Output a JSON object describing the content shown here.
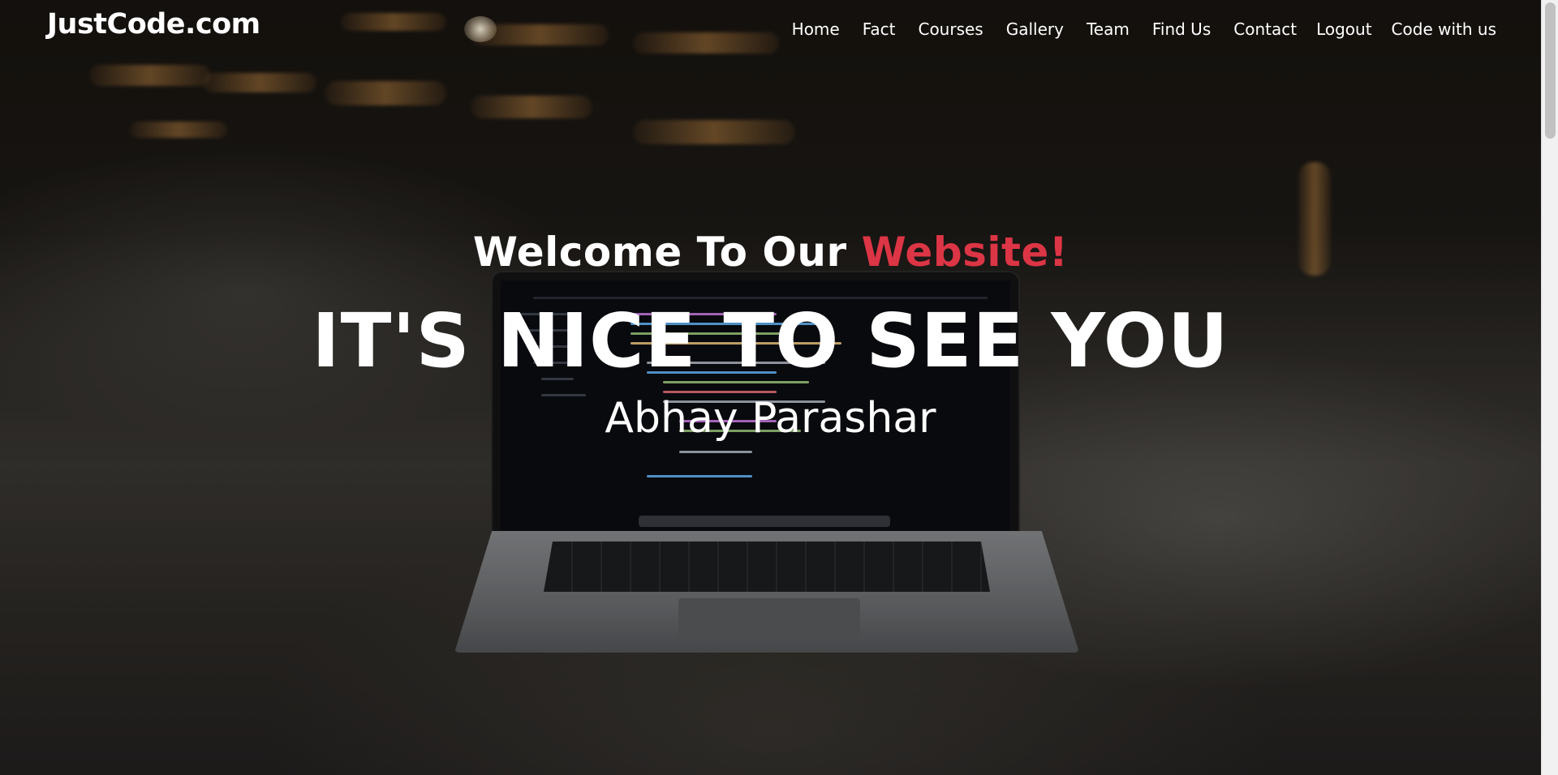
{
  "brand": {
    "name": "JustCode.com"
  },
  "nav": {
    "items": [
      {
        "label": "Home"
      },
      {
        "label": "Fact"
      },
      {
        "label": "Courses"
      },
      {
        "label": "Gallery"
      },
      {
        "label": "Team"
      },
      {
        "label": "Find Us"
      },
      {
        "label": "Contact"
      },
      {
        "label": "Logout"
      },
      {
        "label": "Code with us"
      }
    ]
  },
  "hero": {
    "welcome_prefix": "Welcome To Our ",
    "welcome_accent": "Website!",
    "headline": "IT'S NICE TO SEE YOU",
    "name": "Abhay Parashar",
    "background_image": "laptop-with-code-on-floor"
  },
  "colors": {
    "accent": "#dc3545",
    "text": "#ffffff"
  },
  "scrollbar": {
    "position": 0
  }
}
